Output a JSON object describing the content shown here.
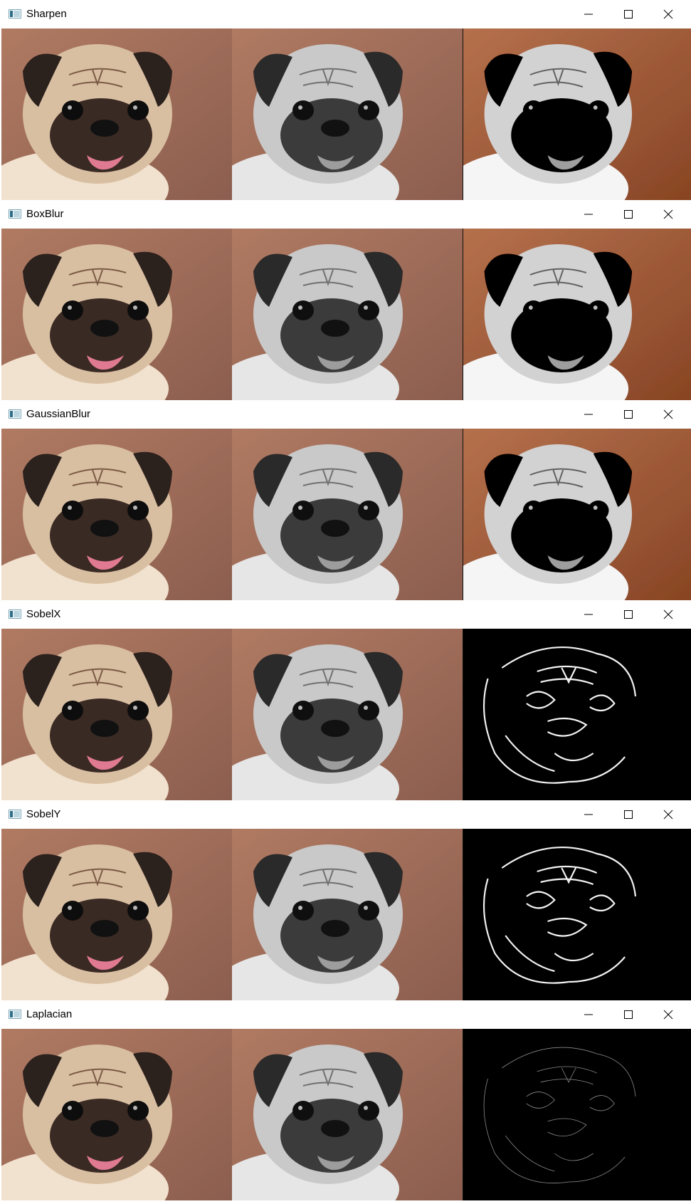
{
  "windows": [
    {
      "title": "Sharpen",
      "third_image_style": "sharpened"
    },
    {
      "title": "BoxBlur",
      "third_image_style": "blurred"
    },
    {
      "title": "GaussianBlur",
      "third_image_style": "blurred"
    },
    {
      "title": "SobelX",
      "third_image_style": "edges-strong"
    },
    {
      "title": "SobelY",
      "third_image_style": "edges-strong"
    },
    {
      "title": "Laplacian",
      "third_image_style": "edges-faint"
    }
  ],
  "image_panels": [
    "color-original",
    "grayscale",
    "filtered"
  ],
  "colors": {
    "titlebar_bg": "#ffffff",
    "title_text": "#000000",
    "background_warm": "#a2705c",
    "background_gray": "#7a7a7a",
    "edge_bg": "#000000"
  },
  "icons": {
    "app": "window-app-icon",
    "minimize": "minimize-icon",
    "maximize": "maximize-icon",
    "close": "close-icon"
  }
}
